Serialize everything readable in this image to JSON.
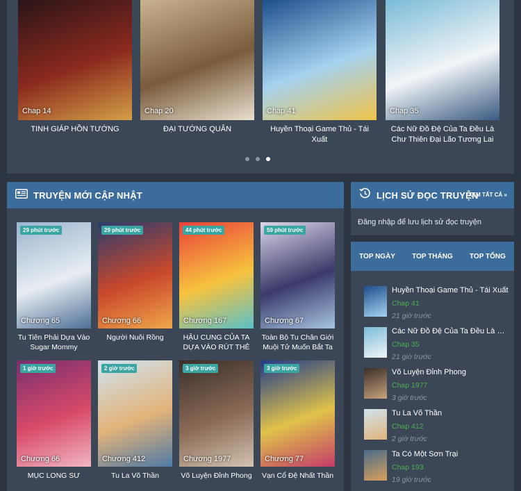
{
  "slider": {
    "items": [
      {
        "chapter": "Chap 14",
        "title": "TINH GIÁP HỒN TƯỚNG",
        "colors": [
          "#2a1418",
          "#8c2a1e",
          "#d4a046"
        ]
      },
      {
        "chapter": "Chap 20",
        "title": "ĐẠI TƯỚNG QUÂN",
        "colors": [
          "#c9b38f",
          "#7a5c3c",
          "#e9e0cf"
        ]
      },
      {
        "chapter": "Chap 41",
        "title": "Huyền Thoại Game Thủ - Tái Xuất",
        "colors": [
          "#1e4f8c",
          "#a6d2ef",
          "#f0c44a"
        ]
      },
      {
        "chapter": "Chap 35",
        "title": "Các Nữ Đồ Đệ Của Ta Đều Là Chư Thiên Đại Lão Tương Lai",
        "colors": [
          "#7bbbd8",
          "#f2f5f7",
          "#3a5a82"
        ]
      }
    ],
    "dots": 3,
    "active_dot": 2
  },
  "new_updates": {
    "title": "TRUYỆN MỚI CẬP NHẬT",
    "items": [
      {
        "badge": "29 phút trước",
        "chapter": "Chương 65",
        "name": "Tu Tiên Phải Dựa Vào Sugar Mommy",
        "colors": [
          "#9bb5cf",
          "#e8edf2",
          "#4d6f96"
        ]
      },
      {
        "badge": "29 phút trước",
        "chapter": "Chương 66",
        "name": "Người Nuôi Rồng",
        "colors": [
          "#2c3c6e",
          "#c9482b",
          "#f0a64a"
        ]
      },
      {
        "badge": "44 phút trước",
        "chapter": "Chương 167",
        "name": "HẬU CUNG CỦA TA DỰA VÀO RÚT THẺ",
        "colors": [
          "#e9413a",
          "#f7c33e",
          "#5ac0c8"
        ]
      },
      {
        "badge": "59 phút trước",
        "chapter": "Chương 67",
        "name": "Toàn Bộ Tu Chân Giới Muội Tử Muốn Bắt Ta",
        "colors": [
          "#dcd8ea",
          "#3b3a6a",
          "#a7c5e3"
        ]
      },
      {
        "badge": "1 giờ trước",
        "chapter": "Chương 66",
        "name": "MỤC LONG SƯ",
        "colors": [
          "#7a2f6e",
          "#d84a6a",
          "#f2b6c3"
        ]
      },
      {
        "badge": "2 giờ trước",
        "chapter": "Chương 412",
        "name": "Tu La Võ Thần",
        "colors": [
          "#cfe3ef",
          "#e2b37a",
          "#4f7aa6"
        ]
      },
      {
        "badge": "3 giờ trước",
        "chapter": "Chương 1977",
        "name": "Võ Luyện Đỉnh Phong",
        "colors": [
          "#3a2f2a",
          "#8a6a55",
          "#d2c3b0"
        ]
      },
      {
        "badge": "3 giờ trước",
        "chapter": "Chương 77",
        "name": "Vạn Cổ Đệ Nhất Thần",
        "colors": [
          "#1f3a8a",
          "#e0c24a",
          "#c33b6a"
        ]
      }
    ]
  },
  "history": {
    "title": "LỊCH SỬ ĐỌC TRUYỆN",
    "see_all": "XEM TẤT CẢ »",
    "message": "Đăng nhập để lưu lịch sử đọc truyện"
  },
  "top": {
    "tabs": [
      "TOP NGÀY",
      "TOP THÁNG",
      "TOP TỔNG"
    ],
    "items": [
      {
        "name": "Huyền Thoại Game Thủ - Tái Xuất",
        "chapter": "Chap 41",
        "time": "21 giờ trước",
        "colors": [
          "#1e4f8c",
          "#a6d2ef"
        ]
      },
      {
        "name": "Các Nữ Đồ Đệ Của Ta Đều Là Chư Thiên Đại Lão Tương Lai",
        "chapter": "Chap 35",
        "time": "21 giờ trước",
        "colors": [
          "#7bbbd8",
          "#f2f5f7"
        ]
      },
      {
        "name": "Võ Luyện Đỉnh Phong",
        "chapter": "Chap 1977",
        "time": "3 giờ trước",
        "colors": [
          "#3a2f2a",
          "#c7a27a"
        ]
      },
      {
        "name": "Tu La Võ Thần",
        "chapter": "Chap 412",
        "time": "2 giờ trước",
        "colors": [
          "#cfe3ef",
          "#e2b37a"
        ]
      },
      {
        "name": "Ta Có Một Sơn Trại",
        "chapter": "Chap 193",
        "time": "19 giờ trước",
        "colors": [
          "#4a6b8a",
          "#d9a05a"
        ]
      }
    ]
  },
  "colors": {
    "page_bg": "#2c3541",
    "panel_bg": "#3b4656",
    "header_blue": "#3c6c9b",
    "badge_teal": "#3aa5a2",
    "chapter_green": "#4caf50"
  }
}
